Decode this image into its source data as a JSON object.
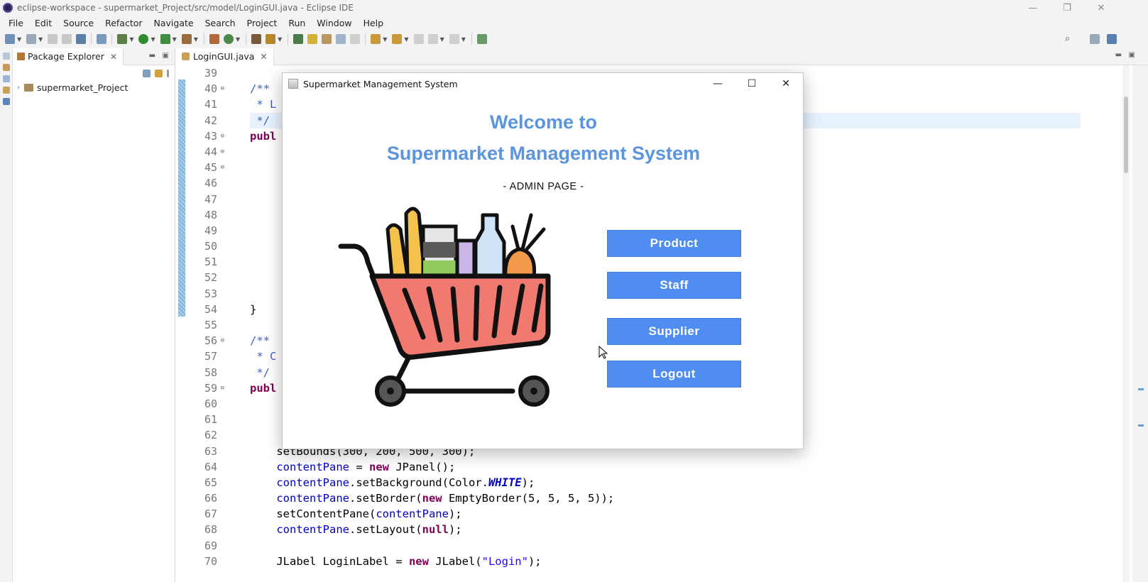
{
  "window": {
    "title": "eclipse-workspace - supermarket_Project/src/model/LoginGUI.java - Eclipse IDE"
  },
  "menu": [
    "File",
    "Edit",
    "Source",
    "Refactor",
    "Navigate",
    "Search",
    "Project",
    "Run",
    "Window",
    "Help"
  ],
  "package_explorer": {
    "tab_label": "Package Explorer",
    "project": "supermarket_Project"
  },
  "editor": {
    "tab_label": "LoginGUI.java",
    "lines": [
      {
        "n": "39",
        "fold": ""
      },
      {
        "n": "40",
        "fold": "⊖"
      },
      {
        "n": "41",
        "fold": ""
      },
      {
        "n": "42",
        "fold": ""
      },
      {
        "n": "43",
        "fold": "⊖"
      },
      {
        "n": "44",
        "fold": "⊖"
      },
      {
        "n": "45",
        "fold": "⊖"
      },
      {
        "n": "46",
        "fold": ""
      },
      {
        "n": "47",
        "fold": ""
      },
      {
        "n": "48",
        "fold": ""
      },
      {
        "n": "49",
        "fold": ""
      },
      {
        "n": "50",
        "fold": ""
      },
      {
        "n": "51",
        "fold": ""
      },
      {
        "n": "52",
        "fold": ""
      },
      {
        "n": "53",
        "fold": ""
      },
      {
        "n": "54",
        "fold": ""
      },
      {
        "n": "55",
        "fold": ""
      },
      {
        "n": "56",
        "fold": "⊖"
      },
      {
        "n": "57",
        "fold": ""
      },
      {
        "n": "58",
        "fold": ""
      },
      {
        "n": "59",
        "fold": "⊖"
      },
      {
        "n": "60",
        "fold": ""
      },
      {
        "n": "61",
        "fold": ""
      },
      {
        "n": "62",
        "fold": ""
      },
      {
        "n": "63",
        "fold": ""
      },
      {
        "n": "64",
        "fold": ""
      },
      {
        "n": "65",
        "fold": ""
      },
      {
        "n": "66",
        "fold": ""
      },
      {
        "n": "67",
        "fold": ""
      },
      {
        "n": "68",
        "fold": ""
      },
      {
        "n": "69",
        "fold": ""
      },
      {
        "n": "70",
        "fold": ""
      }
    ],
    "code": {
      "l40": "/**",
      "l41": " * L",
      "l42": " */",
      "l43": "publ",
      "l54": "}",
      "l56": "/**",
      "l57": " * C",
      "l58": " */",
      "l59": "publ",
      "l63": "    setBounds(300, 200, 500, 300);",
      "l64_a": "contentPane",
      "l64_b": " = ",
      "l64_c": "new",
      "l64_d": " JPanel();",
      "l65_a": "contentPane",
      "l65_b": ".setBackground(Color.",
      "l65_c": "WHITE",
      "l65_d": ");",
      "l66_a": "contentPane",
      "l66_b": ".setBorder(",
      "l66_c": "new",
      "l66_d": " EmptyBorder(5, 5, 5, 5));",
      "l67_a": "setContentPane(",
      "l67_b": "contentPane",
      "l67_c": ");",
      "l68_a": "contentPane",
      "l68_b": ".setLayout(",
      "l68_c": "null",
      "l68_d": ");",
      "l70_a": "JLabel LoginLabel = ",
      "l70_b": "new",
      "l70_c": " JLabel(",
      "l70_d": "\"Login\"",
      "l70_e": ");"
    }
  },
  "dialog": {
    "title": "Supermarket Management System",
    "welcome_line1": "Welcome to",
    "welcome_line2": "Supermarket Management System",
    "subtitle": "- ADMIN PAGE -",
    "buttons": {
      "product": "Product",
      "staff": "Staff",
      "supplier": "Supplier",
      "logout": "Logout"
    }
  },
  "colors": {
    "accent_blue": "#4f8ef0",
    "heading_blue": "#5b95de",
    "keyword": "#7f0055",
    "comment": "#3f5fbf",
    "field": "#0000c0"
  }
}
